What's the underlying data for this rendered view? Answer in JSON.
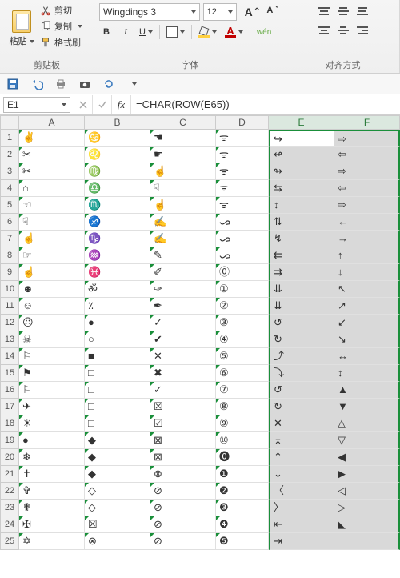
{
  "ribbon": {
    "group1": {
      "label": "剪贴板",
      "paste": "粘贴",
      "cut": "剪切",
      "copy": "复制",
      "formatPainter": "格式刷"
    },
    "group2": {
      "label": "字体",
      "font_name": "Wingdings 3",
      "font_size": "12",
      "bigA": "A",
      "smallA": "A",
      "b": "B",
      "i": "I",
      "u": "U",
      "wrap": "wén"
    },
    "group3": {
      "label": "对齐方式"
    }
  },
  "formulaBar": {
    "nameBox": "E1",
    "formula": "=CHAR(ROW(E65))",
    "fx": "fx"
  },
  "columns": [
    "A",
    "B",
    "C",
    "D",
    "E",
    "F"
  ],
  "chart_data": {
    "type": "table",
    "title": "Wingdings 3 characters from CHAR(ROW(...))",
    "columns": [
      "A",
      "B",
      "C",
      "D",
      "E",
      "F"
    ],
    "rows": [
      [
        "✌",
        "♋",
        "☚",
        "ᯤ",
        "↪",
        "⇨"
      ],
      [
        "✂",
        "♌",
        "☛",
        "ᯤ",
        "↫",
        "⇦"
      ],
      [
        "✂",
        "♍",
        "☝",
        "ᯤ",
        "↬",
        "⇨"
      ],
      [
        "⌂",
        "♎",
        "☟",
        "ᯤ",
        "⇆",
        "⇦"
      ],
      [
        "☜",
        "♏",
        "☝",
        "ᯤ",
        "↕",
        "⇨"
      ],
      [
        "☟",
        "♐",
        "✍",
        "ᯀ",
        "⇅",
        "←"
      ],
      [
        "☝",
        "♑",
        "✍",
        "ᯀ",
        "↯",
        "→"
      ],
      [
        "☞",
        "♒",
        "✎",
        "ᯀ",
        "⇇",
        "↑"
      ],
      [
        "☝",
        "♓",
        "✐",
        "⓪",
        "⇉",
        "↓"
      ],
      [
        "☻",
        "ॐ",
        "✑",
        "①",
        "⇊",
        "↖"
      ],
      [
        "☺",
        "٪",
        "✒",
        "②",
        "⇊",
        "↗"
      ],
      [
        "☹",
        "●",
        "✓",
        "③",
        "↺",
        "↙"
      ],
      [
        "☠",
        "○",
        "✔",
        "④",
        "↻",
        "↘"
      ],
      [
        "⚐",
        "■",
        "✕",
        "⑤",
        "⤴",
        "↔"
      ],
      [
        "⚑",
        "□",
        "✖",
        "⑥",
        "⤵",
        "↕"
      ],
      [
        "⚐",
        "□",
        "✓",
        "⑦",
        "↺",
        "▲"
      ],
      [
        "✈",
        "□",
        "☒",
        "⑧",
        "↻",
        "▼"
      ],
      [
        "☀",
        "□",
        "☑",
        "⑨",
        "✕",
        "△"
      ],
      [
        "●",
        "◆",
        "⊠",
        "⑩",
        "⌅",
        "▽"
      ],
      [
        "❄",
        "◆",
        "⊠",
        "⓿",
        "⌃",
        "◀"
      ],
      [
        "✝",
        "◆",
        "⊗",
        "❶",
        "⌄",
        "▶"
      ],
      [
        "✞",
        "◇",
        "⊘",
        "❷",
        "〈",
        "◁"
      ],
      [
        "✟",
        "◇",
        "⊘",
        "❸",
        "〉",
        "▷"
      ],
      [
        "✠",
        "☒",
        "⊘",
        "❹",
        "⇤",
        "◣"
      ],
      [
        "✡",
        "⊗",
        "⊘",
        "❺",
        "⇥",
        ""
      ]
    ]
  }
}
